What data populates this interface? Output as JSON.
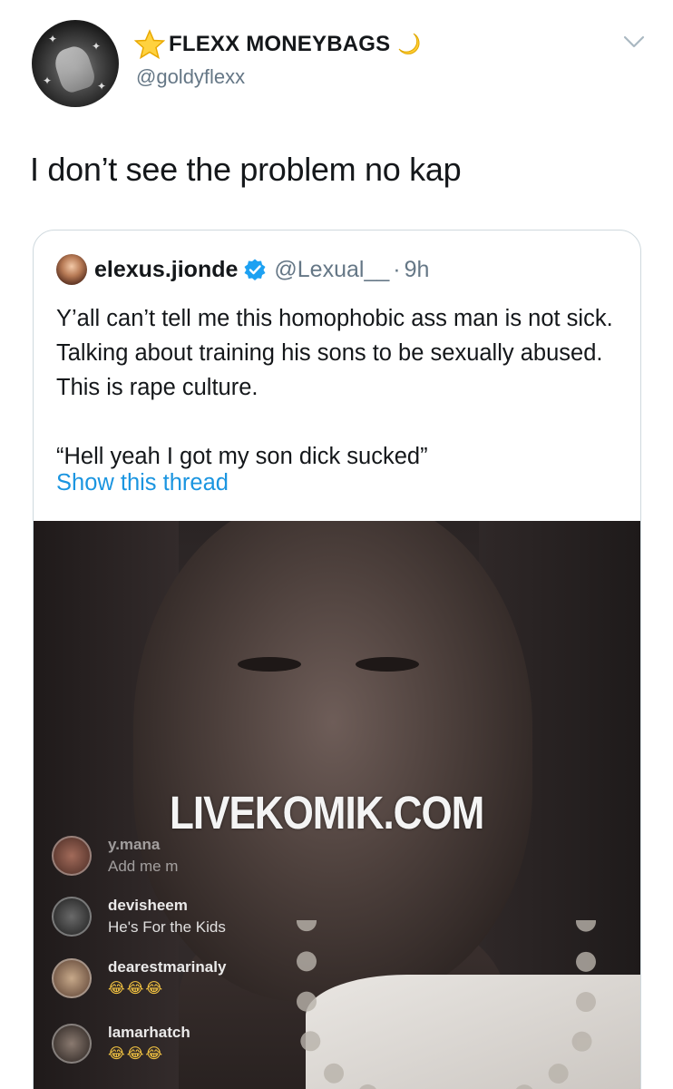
{
  "tweet": {
    "display_name": "FLEXX MONEYBAGS",
    "handle": "@goldyflexx",
    "text": "I don’t see the problem no kap",
    "name_prefix_icon": "star-icon",
    "name_suffix_icon": "crescent-moon-icon",
    "menu_icon": "chevron-down-icon"
  },
  "quoted": {
    "display_name": "elexus.jionde",
    "verified_icon": "verified-badge-icon",
    "handle": "@Lexual__",
    "separator": "·",
    "time": "9h",
    "paragraph1": "Y’all can’t tell me this homophobic ass man is not sick. Talking about training his sons to be sexually abused. This is rape culture.",
    "paragraph2": "“Hell yeah I got my son dick sucked”",
    "show_thread": "Show this thread",
    "media": {
      "watermark": "LIVEKOMIK.COM",
      "comments": [
        {
          "user": "y.mana",
          "message": "Add me m"
        },
        {
          "user": "devisheem",
          "message": "He's For the Kids"
        },
        {
          "user": "dearestmarinaly",
          "message": "😂😂😂"
        },
        {
          "user": "lamarhatch",
          "message": "😂😂😂"
        }
      ]
    }
  },
  "colors": {
    "text": "#14171a",
    "secondary": "#657786",
    "link": "#1b95e0",
    "border": "#cfd9de",
    "verified": "#1da1f2"
  }
}
